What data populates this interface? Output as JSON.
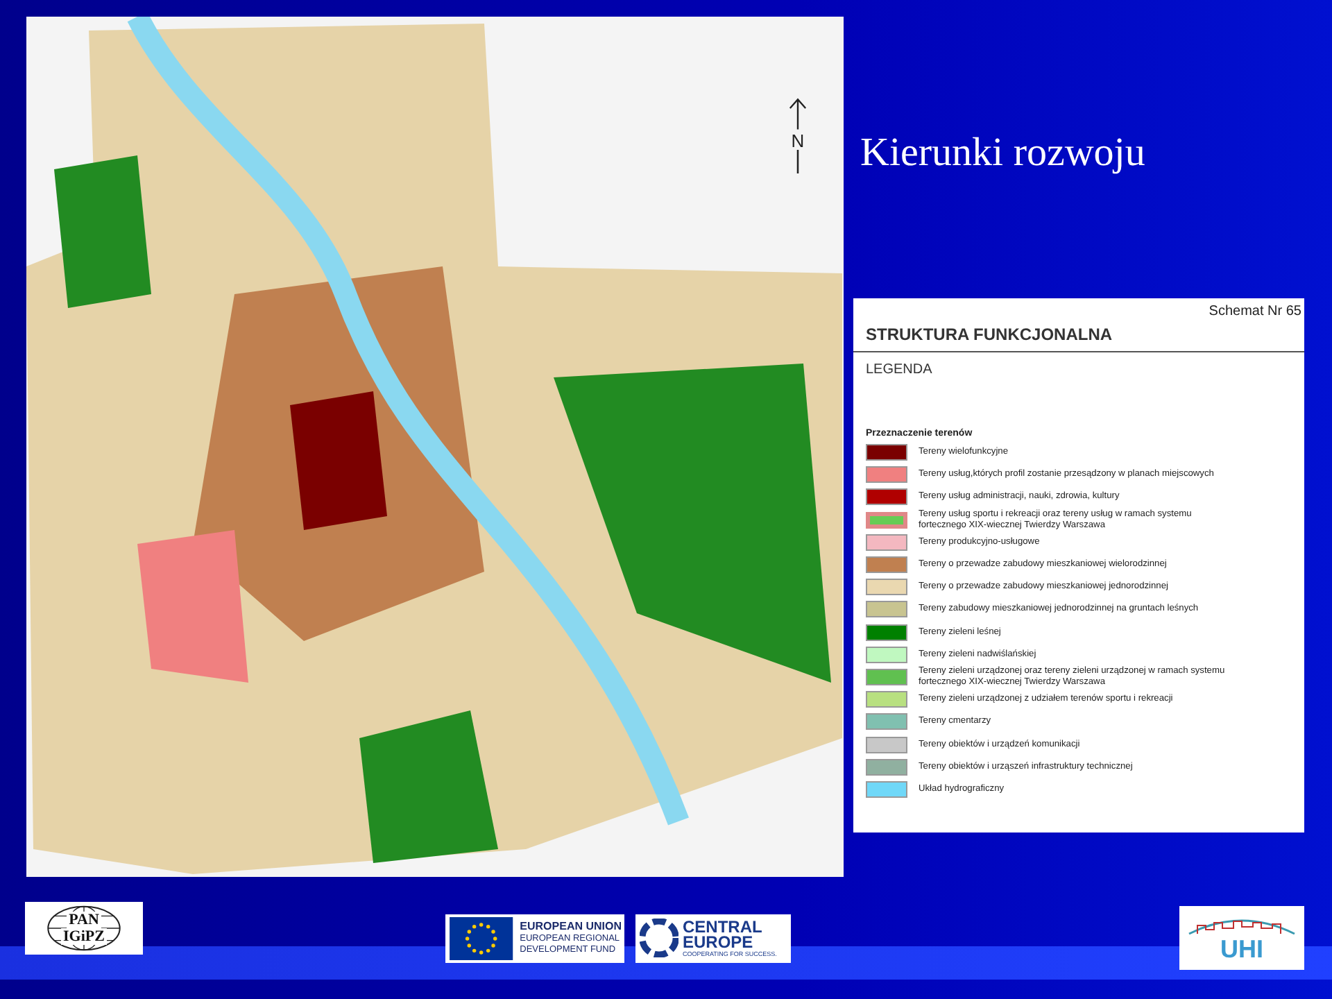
{
  "slide": {
    "title": "Kierunki rozwoju"
  },
  "map": {
    "north_label": "N"
  },
  "legend": {
    "scheme": "Schemat Nr 65",
    "title": "STRUKTURA FUNKCJONALNA",
    "subtitle": "LEGENDA",
    "section": "Przeznaczenie terenów",
    "items": [
      {
        "kind": "plain",
        "color": "#7a0000",
        "label": "Tereny wielofunkcyjne"
      },
      {
        "kind": "plain",
        "color": "#f08080",
        "label": "Tereny usług,których profil zostanie przesądzony w planach miejscowych"
      },
      {
        "kind": "plain",
        "color": "#b00000",
        "label": "Tereny usług administracji, nauki, zdrowia, kultury"
      },
      {
        "kind": "framed",
        "color": "#66cc55",
        "label": "Tereny usług sportu i rekreacji oraz tereny usług w ramach systemu fortecznego XIX-wiecznej Twierdzy Warszawa"
      },
      {
        "kind": "plain",
        "color": "#f4b8c0",
        "label": "Tereny produkcyjno-usługowe"
      },
      {
        "kind": "plain",
        "color": "#c08050",
        "label": "Tereny o przewadze zabudowy mieszkaniowej wielorodzinnej"
      },
      {
        "kind": "plain",
        "color": "#ead8b0",
        "label": "Tereny o przewadze zabudowy mieszkaniowej jednorodzinnej"
      },
      {
        "kind": "plain",
        "color": "#c8c490",
        "label": "Tereny zabudowy mieszkaniowej jednorodzinnej na gruntach leśnych"
      },
      {
        "kind": "plain",
        "color": "#008000",
        "label": "Tereny zieleni leśnej"
      },
      {
        "kind": "plain",
        "color": "#c0f8c0",
        "label": "Tereny zieleni nadwiślańskiej"
      },
      {
        "kind": "plain",
        "color": "#60c050",
        "label": "Tereny zieleni urządzonej oraz tereny zieleni urządzonej w ramach systemu fortecznego XIX-wiecznej Twierdzy Warszawa"
      },
      {
        "kind": "plain",
        "color": "#b8e080",
        "label": "Tereny zieleni urządzonej z udziałem terenów sportu i rekreacji"
      },
      {
        "kind": "plain",
        "color": "#80c0b0",
        "label": "Tereny cmentarzy"
      },
      {
        "kind": "plain",
        "color": "#c8c8c8",
        "label": "Tereny obiektów i urządzeń komunikacji"
      },
      {
        "kind": "plain",
        "color": "#90b0a0",
        "label": "Tereny obiektów i urząszeń infrastruktury technicznej"
      },
      {
        "kind": "plain",
        "color": "#70d8f8",
        "label": "Układ hydrograficzny"
      }
    ]
  },
  "footer": {
    "pan_logo": [
      "PAN",
      "IGiPZ"
    ],
    "eu_logo": [
      "EUROPEAN UNION",
      "EUROPEAN REGIONAL",
      "DEVELOPMENT FUND"
    ],
    "ce_logo": {
      "name": [
        "CENTRAL",
        "EUROPE"
      ],
      "tagline": "COOPERATING FOR SUCCESS."
    },
    "uhi_logo": "UHI"
  }
}
